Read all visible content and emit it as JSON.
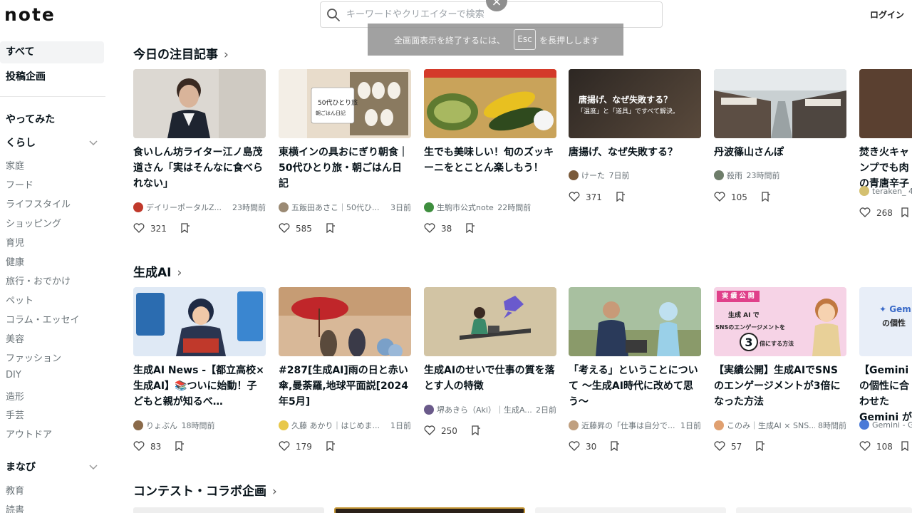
{
  "header": {
    "logo": "note",
    "search_placeholder": "キーワードやクリエイターで検索",
    "login": "ログイン"
  },
  "fullscreen": {
    "close": "×",
    "text_before": "全画面表示を終了するには、",
    "key": "Esc",
    "text_after": "を長押しします"
  },
  "sidebar": {
    "top_items": [
      "すべて",
      "投稿企画"
    ],
    "yattemita": "やってみた",
    "kurashi": "くらし",
    "kurashi_items": [
      "家庭",
      "フード",
      "ライフスタイル",
      "ショッピング",
      "育児",
      "健康",
      "旅行・おでかけ",
      "ペット",
      "コラム・エッセイ",
      "美容",
      "ファッション",
      "DIY",
      "造形",
      "手芸",
      "アウトドア"
    ],
    "manabi": "まなび",
    "manabi_items": [
      "教育",
      "読書"
    ]
  },
  "sections": {
    "featured": "今日の注目記事",
    "ai": "生成AI",
    "contest": "コンテスト・コラボ企画"
  },
  "featured_cards": [
    {
      "title": "食いしん坊ライター江ノ島茂道さん「実はそんなに食べられない」",
      "author": "デイリーポータルZ...",
      "time": "23時間前",
      "likes": "321",
      "thumb_color": "#d9d4cc",
      "avatar_color": "#c0392b"
    },
    {
      "title": "東横インの具おにぎり朝食｜50代ひとり旅・朝ごはん日記",
      "author": "五飯田あさこ｜50代ひ...",
      "time": "3日前",
      "likes": "585",
      "thumb_color": "#e8dccb",
      "avatar_color": "#9b8a74"
    },
    {
      "title": "生でも美味しい！旬のズッキーニをとことん楽しもう！",
      "author": "生駒市公式note",
      "time": "22時間前",
      "likes": "38",
      "thumb_color": "#7a8a3a",
      "avatar_color": "#3e8e3e"
    },
    {
      "title": "唐揚げ、なぜ失敗する？",
      "author": "けーた",
      "time": "7日前",
      "likes": "371",
      "thumb_color": "#3a3330",
      "avatar_color": "#7a5a3a",
      "thumb_text": "唐揚げ、なぜ失敗する？",
      "thumb_sub": "「温度」と「道具」ですべて解決。"
    },
    {
      "title": "丹波篠山さんぽ",
      "author": "殺雨",
      "time": "23時間前",
      "likes": "105",
      "thumb_color": "#a9b3b5",
      "avatar_color": "#6e7d6a"
    },
    {
      "title": "焚き火キャンプでも肉の青唐辛子",
      "author": "teraken_ 4",
      "time": "",
      "likes": "268",
      "thumb_color": "#5a4030",
      "avatar_color": "#d4c070"
    }
  ],
  "ai_cards": [
    {
      "title": "生成AI News -【都立高校×生成AI】📚ついに始動！子どもと親が知るべ…",
      "author": "りょぶん",
      "time": "18時間前",
      "likes": "83",
      "thumb_color": "#2b6cb0",
      "avatar_color": "#8a6a4a"
    },
    {
      "title": "#287[生成AI]雨の日と赤い傘,曼荼羅,地球平面説[2024年5月]",
      "author": "久藤 あかり｜はじめま...",
      "time": "1日前",
      "likes": "179",
      "thumb_color": "#c9a07a",
      "avatar_color": "#e8c84a"
    },
    {
      "title": "生成AIのせいで仕事の質を落とす人の特徴",
      "author": "堺あきら（Aki）｜生成A...",
      "time": "2日前",
      "likes": "250",
      "thumb_color": "#c8b89a",
      "avatar_color": "#6a5a8a"
    },
    {
      "title": "「考える」ということについて 〜生成AI時代に改めて思う〜",
      "author": "近藤昇の「仕事は自分で...",
      "time": "1日前",
      "likes": "30",
      "thumb_color": "#8aa88a",
      "avatar_color": "#c0a080"
    },
    {
      "title": "【実績公開】生成AIでSNSのエンゲージメントが3倍になった方法",
      "author": "このみ｜生成AI × SNS...",
      "time": "8時間前",
      "likes": "57",
      "thumb_color": "#f6d3e6",
      "avatar_color": "#e0a070",
      "thumb_tag": "実 績 公 開",
      "thumb_line1": "生成 AI で",
      "thumb_line2": "SNSのエンゲージメントを",
      "thumb_line3": "3",
      "thumb_line4": "倍にする方法"
    },
    {
      "title": "【Gemini の個性に合わせた Gemini が",
      "author": "Gemini - G",
      "time": "",
      "likes": "108",
      "thumb_color": "#e8eef8",
      "avatar_color": "#4a7ad8",
      "thumb_text": "✦ Gem",
      "thumb_sub": "の個性"
    }
  ]
}
